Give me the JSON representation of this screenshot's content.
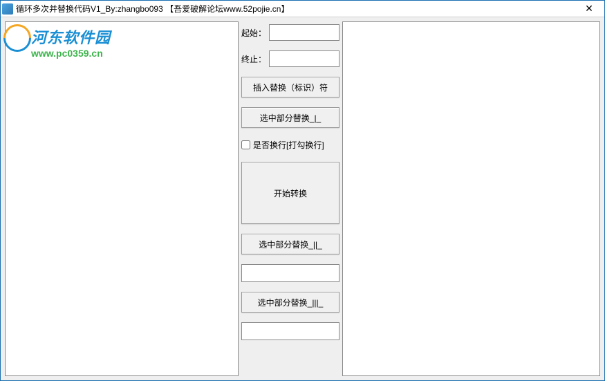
{
  "window": {
    "title": "循环多次并替换代码V1_By:zhangbo093 【吾爱破解论坛www.52pojie.cn】"
  },
  "watermark": {
    "main": "河东软件园",
    "sub": "www.pc0359.cn"
  },
  "left_text": "",
  "right_text": "",
  "middle": {
    "start_label": "起始：",
    "start_value": "",
    "end_label": "终止：",
    "end_value": "",
    "insert_marker_btn": "插入替换（标识）符",
    "replace_selected_1_btn": "选中部分替换_|_",
    "linebreak_checkbox": "是否换行[打勾换行]",
    "linebreak_checked": false,
    "start_convert_btn": "开始转换",
    "replace_selected_2_btn": "选中部分替换_||_",
    "input2_value": "",
    "replace_selected_3_btn": "选中部分替换_|||_",
    "input3_value": ""
  }
}
